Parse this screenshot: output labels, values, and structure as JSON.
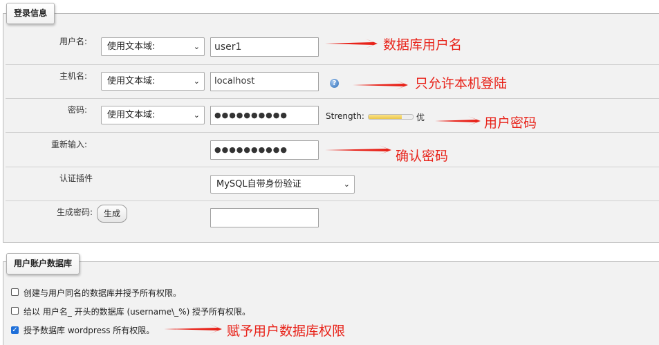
{
  "login": {
    "legend": "登录信息",
    "username": {
      "label": "用户名:",
      "select": "使用文本域:",
      "value": "user1"
    },
    "host": {
      "label": "主机名:",
      "select": "使用文本域:",
      "value": "localhost",
      "help_icon": "help-icon"
    },
    "password": {
      "label": "密码:",
      "select": "使用文本域:",
      "value": "●●●●●●●●●●",
      "strength_label": "Strength:",
      "strength_level": 0.75,
      "strength_text": "优"
    },
    "retype": {
      "label": "重新输入:",
      "value": "●●●●●●●●●●"
    },
    "auth_plugin": {
      "label": "认证插件",
      "select": "MySQL自带身份验证"
    },
    "generate": {
      "label": "生成密码:",
      "button": "生成",
      "value": ""
    }
  },
  "database": {
    "legend": "用户账户数据库",
    "options": [
      {
        "label": "创建与用户同名的数据库并授予所有权限。",
        "checked": false
      },
      {
        "label": "给以 用户名_ 开头的数据库 (username\\_%) 授予所有权限。",
        "checked": false
      },
      {
        "label": "授予数据库 wordpress 所有权限。",
        "checked": true
      }
    ]
  },
  "annotations": {
    "username": "数据库用户名",
    "host": "只允许本机登陆",
    "password": "用户密码",
    "retype": "确认密码",
    "privileges": "赋予用户数据库权限",
    "color": "#e8231a"
  }
}
